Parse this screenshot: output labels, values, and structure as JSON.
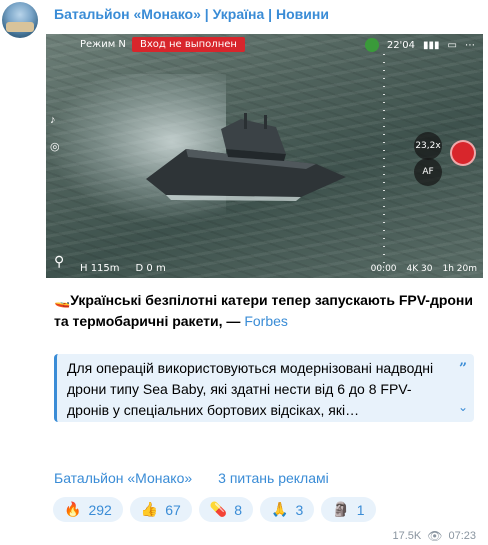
{
  "channel": {
    "title": "Батальйон «Монако» | Україна | Новини"
  },
  "media": {
    "hud_mode": "Режим N",
    "hud_warning": "Вход не выполнен",
    "hud_time": "22'04",
    "zoom": "23,2x",
    "af": "AF",
    "hud_bottom_left_1": "H 115m",
    "hud_bottom_left_2": "D 0 m",
    "hud_bottom_right_1": "00:00",
    "hud_bottom_right_2": "4K 30",
    "hud_bottom_right_3": "1h 20m"
  },
  "post": {
    "boat_emoji": "🚤",
    "headline": "Українські безпілотні катери тепер запускають FPV-дрони та термобаричні ракети, — ",
    "source": "Forbes",
    "quote": "Для операцій використовуються модернізовані надводні дрони типу Sea Baby, які здатні нести від 6 до 8 FPV-дронів у спеціальних бортових відсіках, які…"
  },
  "footer": {
    "channel_link": "Батальйон «Монако»",
    "ads_link": "3 питань рекламі"
  },
  "reactions": [
    {
      "emoji": "🔥",
      "count": "292"
    },
    {
      "emoji": "👍",
      "count": "67"
    },
    {
      "emoji": "💊",
      "count": "8"
    },
    {
      "emoji": "🙏",
      "count": "3"
    },
    {
      "emoji": "🗿",
      "count": "1"
    }
  ],
  "meta": {
    "views": "17.5K",
    "time": "07:23"
  },
  "colors": {
    "accent": "#3a8cd6",
    "quote_bg": "#e8f2fb",
    "warning": "#d8262c"
  }
}
